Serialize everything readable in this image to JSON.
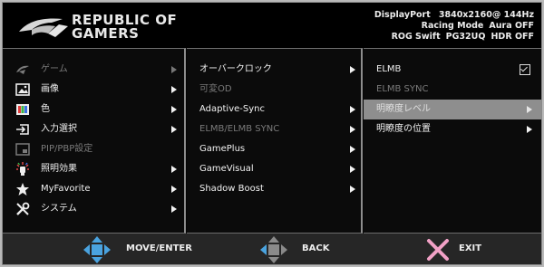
{
  "header": {
    "brand_line1": "REPUBLIC OF",
    "brand_line2": "GAMERS",
    "status": {
      "input": "DisplayPort",
      "resolution": "3840x2160@ 144Hz",
      "mode_label": "Racing Mode",
      "aura_label": "Aura OFF",
      "model_prefix": "ROG Swift",
      "model": "PG32UQ",
      "hdr_label": "HDR OFF"
    }
  },
  "main_menu": [
    {
      "label": "ゲーム",
      "icon": "rog-icon",
      "dim": true,
      "arrow": true
    },
    {
      "label": "画像",
      "icon": "image-icon",
      "dim": false,
      "arrow": true
    },
    {
      "label": "色",
      "icon": "color-icon",
      "dim": false,
      "arrow": true
    },
    {
      "label": "入力選択",
      "icon": "input-icon",
      "dim": false,
      "arrow": true
    },
    {
      "label": "PIP/PBP設定",
      "icon": "pip-icon",
      "dim": true,
      "arrow": false
    },
    {
      "label": "照明効果",
      "icon": "lighting-icon",
      "dim": false,
      "arrow": true
    },
    {
      "label": "MyFavorite",
      "icon": "star-icon",
      "dim": false,
      "arrow": true
    },
    {
      "label": "システム",
      "icon": "tools-icon",
      "dim": false,
      "arrow": true
    }
  ],
  "sub_menu": [
    {
      "label": "オーバークロック",
      "dim": false,
      "arrow": true
    },
    {
      "label": "可変OD",
      "dim": true,
      "arrow": false
    },
    {
      "label": "Adaptive-Sync",
      "dim": false,
      "arrow": true
    },
    {
      "label": "ELMB/ELMB SYNC",
      "dim": true,
      "arrow": true
    },
    {
      "label": "GamePlus",
      "dim": false,
      "arrow": true
    },
    {
      "label": "GameVisual",
      "dim": false,
      "arrow": true
    },
    {
      "label": "Shadow Boost",
      "dim": false,
      "arrow": true
    }
  ],
  "options": [
    {
      "label": "ELMB",
      "dim": false,
      "checked": true,
      "selected": false
    },
    {
      "label": "ELMB SYNC",
      "dim": true,
      "checked": false,
      "selected": false
    },
    {
      "label": "明瞭度レベル",
      "dim": false,
      "checked": false,
      "selected": true
    },
    {
      "label": "明瞭度の位置",
      "dim": false,
      "checked": false,
      "selected": false
    }
  ],
  "footer": {
    "move_label": "MOVE/ENTER",
    "back_label": "BACK",
    "exit_label": "EXIT"
  },
  "colors": {
    "dpad_blue": "#4aa3df",
    "dpad_gray": "#8a8a8a",
    "exit_pink": "#f1a1c6",
    "selected_row": "#8e8e8e"
  }
}
